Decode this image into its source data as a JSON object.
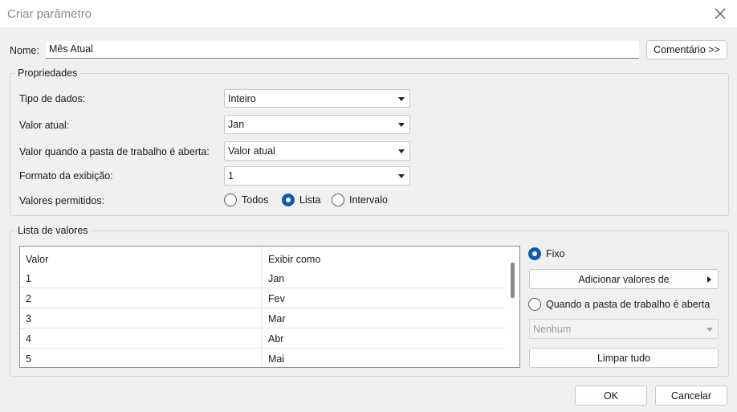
{
  "dialog": {
    "title": "Criar parâmetro"
  },
  "name_row": {
    "label": "Nome:",
    "value": "Mês Atual",
    "comment_button": "Comentário >>"
  },
  "properties": {
    "title": "Propriedades",
    "data_type": {
      "label": "Tipo de dados:",
      "value": "Inteiro"
    },
    "current_value": {
      "label": "Valor atual:",
      "value": "Jan"
    },
    "value_on_open": {
      "label": "Valor quando a pasta de trabalho é aberta:",
      "value": "Valor atual"
    },
    "display_format": {
      "label": "Formato da exibição:",
      "value": "1"
    },
    "allowable": {
      "label": "Valores permitidos:",
      "options": [
        "Todos",
        "Lista",
        "Intervalo"
      ],
      "selected": "Lista"
    }
  },
  "value_list": {
    "title": "Lista de valores",
    "columns": [
      "Valor",
      "Exibir como"
    ],
    "rows": [
      {
        "value": "1",
        "display": "Jan"
      },
      {
        "value": "2",
        "display": "Fev"
      },
      {
        "value": "3",
        "display": "Mar"
      },
      {
        "value": "4",
        "display": "Abr"
      },
      {
        "value": "5",
        "display": "Mai"
      }
    ],
    "fixed_label": "Fixo",
    "add_values_button": "Adicionar valores de",
    "on_open_label": "Quando a pasta de trabalho é aberta",
    "on_open_select": "Nenhum",
    "clear_button": "Limpar tudo"
  },
  "footer": {
    "ok": "OK",
    "cancel": "Cancelar"
  },
  "colors": {
    "accent": "#0b5cad",
    "background": "#f0f0f0"
  }
}
